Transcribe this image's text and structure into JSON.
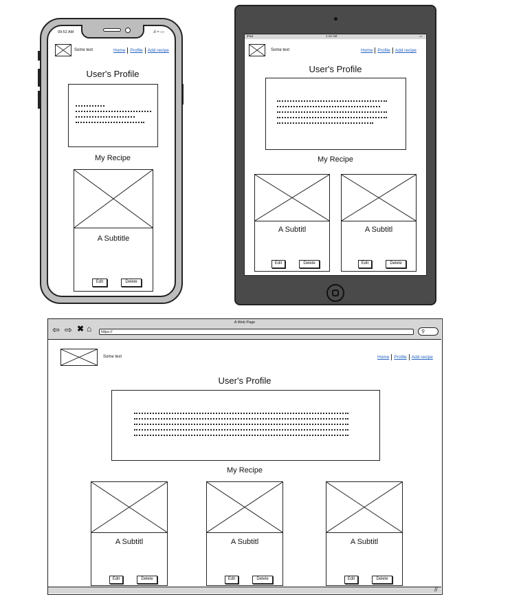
{
  "common": {
    "some_text": "Some text",
    "nav": [
      "Home",
      "Profile",
      "Add recipe"
    ],
    "page_title": "User's Profile",
    "section_title": "My Recipe",
    "edit": "Edit",
    "delete": "Delete"
  },
  "phone": {
    "time": "09:52 AM",
    "card_subtitle": "A Subtitle"
  },
  "tablet": {
    "status_left": "iPad",
    "status_time": "1:12 AM",
    "cards": [
      {
        "subtitle": "A Subtitl"
      },
      {
        "subtitle": "A Subtitl"
      }
    ]
  },
  "browser": {
    "window_title": "A Web Page",
    "url": "https://",
    "cards": [
      {
        "subtitle": "A Subtitl"
      },
      {
        "subtitle": "A Subtitl"
      },
      {
        "subtitle": "A Subtitl"
      }
    ]
  }
}
